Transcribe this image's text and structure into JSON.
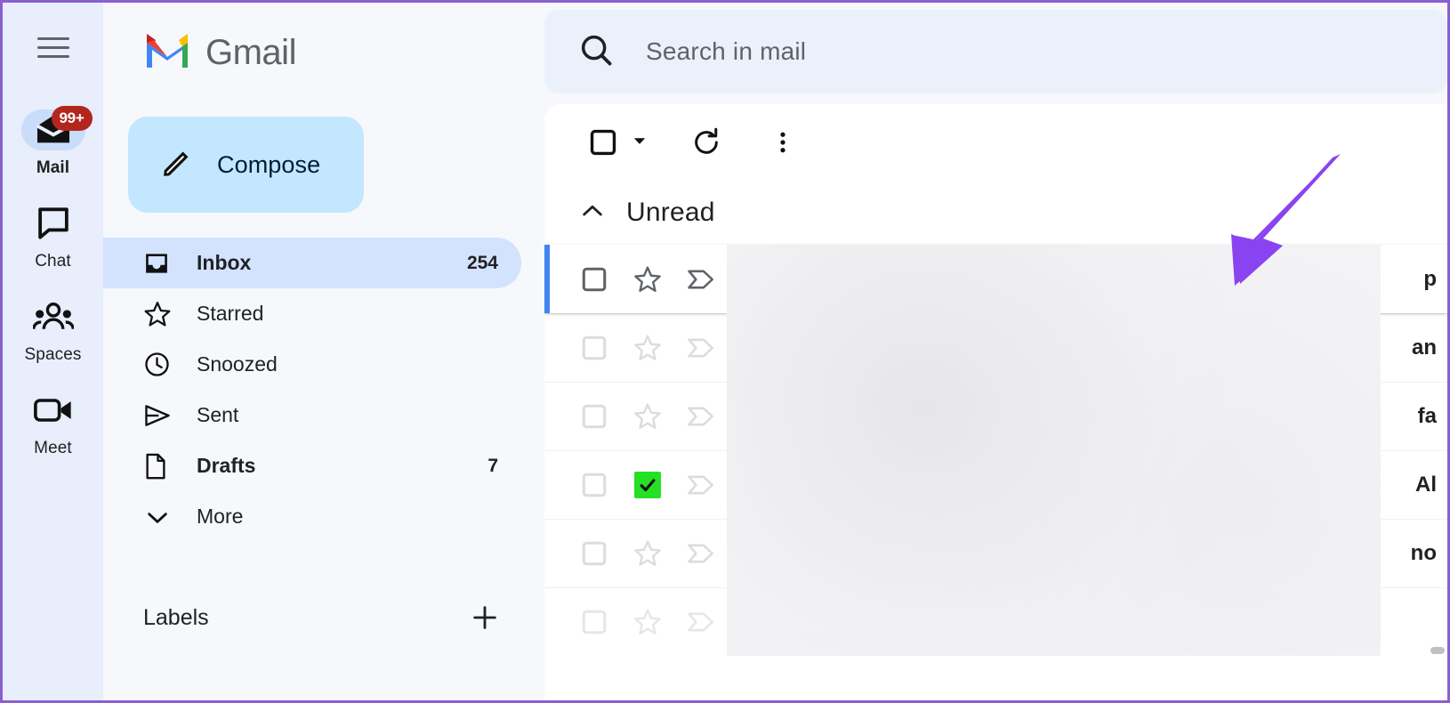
{
  "window": {
    "frame_color": "#8b5fd0"
  },
  "rail": {
    "menu_icon": "hamburger-menu-icon",
    "items": [
      {
        "label": "Mail",
        "icon": "mail-icon",
        "badge": "99+",
        "active": true
      },
      {
        "label": "Chat",
        "icon": "chat-icon",
        "badge": "",
        "active": false
      },
      {
        "label": "Spaces",
        "icon": "spaces-icon",
        "badge": "",
        "active": false
      },
      {
        "label": "Meet",
        "icon": "meet-icon",
        "badge": "",
        "active": false
      }
    ],
    "badge_color": "#b3261e",
    "background": "#e8eefb"
  },
  "brand": {
    "name": "Gmail",
    "logo": "gmail-logo-icon"
  },
  "compose": {
    "label": "Compose",
    "icon": "pencil-icon",
    "background": "#c2e7ff"
  },
  "nav": {
    "items": [
      {
        "label": "Inbox",
        "icon": "inbox-icon",
        "count": "254",
        "active": true,
        "bold": true
      },
      {
        "label": "Starred",
        "icon": "star-icon",
        "count": "",
        "active": false,
        "bold": false
      },
      {
        "label": "Snoozed",
        "icon": "clock-icon",
        "count": "",
        "active": false,
        "bold": false
      },
      {
        "label": "Sent",
        "icon": "send-icon",
        "count": "",
        "active": false,
        "bold": false
      },
      {
        "label": "Drafts",
        "icon": "draft-icon",
        "count": "7",
        "active": false,
        "bold": true
      },
      {
        "label": "More",
        "icon": "chevron-down-icon",
        "count": "",
        "active": false,
        "bold": false
      }
    ],
    "active_background": "#d3e3fd"
  },
  "labels": {
    "title": "Labels",
    "add_icon": "plus-icon"
  },
  "search": {
    "placeholder": "Search in mail",
    "icon": "search-icon"
  },
  "toolbar": {
    "select_all_icon": "checkbox-icon",
    "select_dropdown_icon": "caret-down-icon",
    "refresh_icon": "refresh-icon",
    "more_icon": "more-vertical-icon"
  },
  "section": {
    "title": "Unread",
    "collapse_icon": "chevron-up-icon"
  },
  "mail_rows": [
    {
      "checked": false,
      "star": "empty",
      "important": "dark",
      "selected": true,
      "snippet": "p"
    },
    {
      "checked": false,
      "star": "empty",
      "important": "light",
      "selected": false,
      "snippet": "an"
    },
    {
      "checked": false,
      "star": "empty",
      "important": "light",
      "selected": false,
      "snippet": "fa"
    },
    {
      "checked": false,
      "star": "green",
      "important": "light",
      "selected": false,
      "snippet": "Al"
    },
    {
      "checked": false,
      "star": "empty",
      "important": "light",
      "selected": false,
      "snippet": "no"
    },
    {
      "checked": false,
      "star": "empty",
      "important": "light",
      "selected": false,
      "snippet": ""
    }
  ],
  "annotation": {
    "type": "arrow",
    "color": "#8a43f0",
    "points_to": "star-icon-of-first-row"
  },
  "colors": {
    "selected_row_accent": "#4285f4",
    "green_star": "#25e025",
    "list_background": "#ffffff"
  }
}
